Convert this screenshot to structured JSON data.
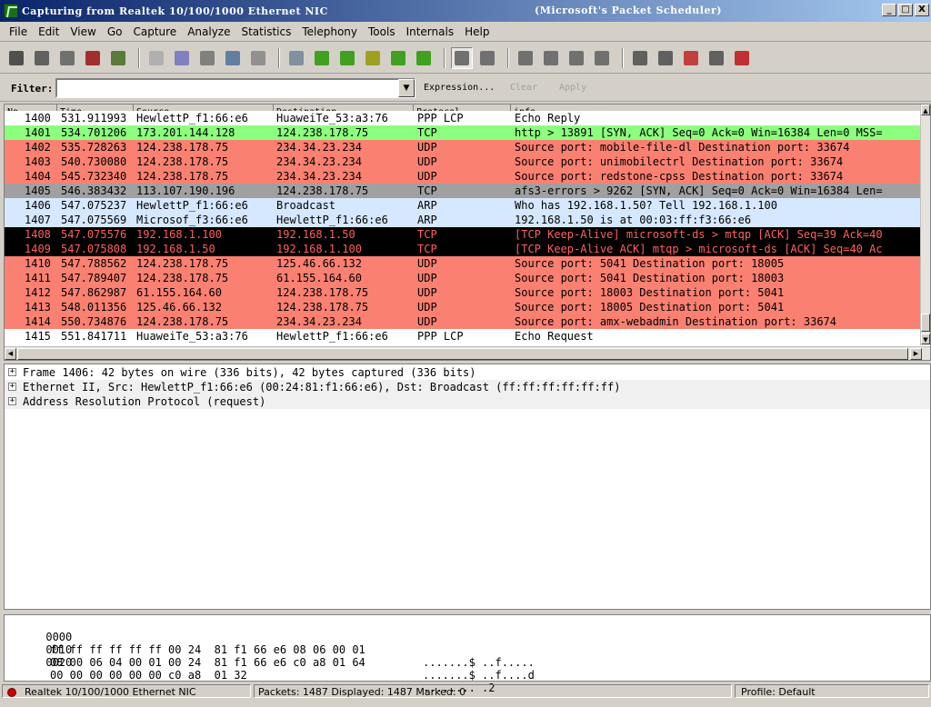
{
  "window": {
    "title": "Capturing from Realtek 10/100/1000 Ethernet NIC",
    "title_part2": "(Microsoft's Packet Scheduler)",
    "controls": [
      "_",
      "□",
      "X"
    ]
  },
  "menu": [
    "File",
    "Edit",
    "View",
    "Go",
    "Capture",
    "Analyze",
    "Statistics",
    "Telephony",
    "Tools",
    "Internals",
    "Help"
  ],
  "toolbar": {
    "icons": [
      {
        "name": "interfaces-icon",
        "color": "#505050"
      },
      {
        "name": "options-icon",
        "color": "#606060"
      },
      {
        "name": "start-capture-icon",
        "color": "#707070"
      },
      {
        "name": "stop-capture-icon",
        "color": "#a03030"
      },
      {
        "name": "restart-capture-icon",
        "color": "#5a7a3a"
      },
      {
        "name": "open-icon",
        "color": "#b0b0b0"
      },
      {
        "name": "save-icon",
        "color": "#8080c0"
      },
      {
        "name": "close-icon",
        "color": "#808080"
      },
      {
        "name": "reload-icon",
        "color": "#6080a0"
      },
      {
        "name": "print-icon",
        "color": "#909090"
      },
      {
        "name": "find-icon",
        "color": "#8090a0"
      },
      {
        "name": "back-icon",
        "color": "#40a020"
      },
      {
        "name": "forward-icon",
        "color": "#40a020"
      },
      {
        "name": "goto-icon",
        "color": "#a0a020"
      },
      {
        "name": "first-packet-icon",
        "color": "#40a020"
      },
      {
        "name": "last-packet-icon",
        "color": "#40a020"
      },
      {
        "name": "colorize-icon",
        "color": "#707070"
      },
      {
        "name": "autoscroll-icon",
        "color": "#707070"
      },
      {
        "name": "zoom-in-icon",
        "color": "#707070"
      },
      {
        "name": "zoom-out-icon",
        "color": "#707070"
      },
      {
        "name": "normal-size-icon",
        "color": "#707070"
      },
      {
        "name": "resize-columns-icon",
        "color": "#707070"
      },
      {
        "name": "capture-filters-icon",
        "color": "#606060"
      },
      {
        "name": "display-filters-icon",
        "color": "#606060"
      },
      {
        "name": "coloring-rules-icon",
        "color": "#c04040"
      },
      {
        "name": "preferences-icon",
        "color": "#606060"
      },
      {
        "name": "help-icon",
        "color": "#c03030"
      }
    ]
  },
  "filter": {
    "label": "Filter:",
    "value": "",
    "expression": "Expression...",
    "clear": "Clear",
    "apply": "Apply"
  },
  "packet_list": {
    "columns": [
      "No.",
      "Time",
      "Source",
      "Destination",
      "Protocol",
      "info."
    ],
    "rows": [
      {
        "no": "1400",
        "time": "531.911993",
        "src": "HewlettP_f1:66:e6",
        "dst": "HuaweiTe_53:a3:76",
        "proto": "PPP LCP",
        "info": "Echo Reply",
        "bg": "#ffffff",
        "fg": "#000000"
      },
      {
        "no": "1401",
        "time": "534.701206",
        "src": "173.201.144.128",
        "dst": "124.238.178.75",
        "proto": "TCP",
        "info": "http > 13891 [SYN, ACK] Seq=0 Ack=0 Win=16384 Len=0 MSS=",
        "bg": "#8cff7f",
        "fg": "#000000"
      },
      {
        "no": "1402",
        "time": "535.728263",
        "src": "124.238.178.75",
        "dst": "234.34.23.234",
        "proto": "UDP",
        "info": "Source port: mobile-file-dl  Destination port: 33674",
        "bg": "#fa8072",
        "fg": "#000000"
      },
      {
        "no": "1403",
        "time": "540.730080",
        "src": "124.238.178.75",
        "dst": "234.34.23.234",
        "proto": "UDP",
        "info": "Source port: unimobilectrl  Destination port: 33674",
        "bg": "#fa8072",
        "fg": "#000000"
      },
      {
        "no": "1404",
        "time": "545.732340",
        "src": "124.238.178.75",
        "dst": "234.34.23.234",
        "proto": "UDP",
        "info": "Source port: redstone-cpss  Destination port: 33674",
        "bg": "#fa8072",
        "fg": "#000000"
      },
      {
        "no": "1405",
        "time": "546.383432",
        "src": "113.107.190.196",
        "dst": "124.238.178.75",
        "proto": "TCP",
        "info": "afs3-errors > 9262 [SYN, ACK] Seq=0 Ack=0 Win=16384 Len=",
        "bg": "#a0a0a0",
        "fg": "#000000"
      },
      {
        "no": "1406",
        "time": "547.075237",
        "src": "HewlettP_f1:66:e6",
        "dst": "Broadcast",
        "proto": "ARP",
        "info": "Who has 192.168.1.50?  Tell 192.168.1.100",
        "bg": "#d6e8ff",
        "fg": "#000000"
      },
      {
        "no": "1407",
        "time": "547.075569",
        "src": "Microsof_f3:66:e6",
        "dst": "HewlettP_f1:66:e6",
        "proto": "ARP",
        "info": "192.168.1.50 is at 00:03:ff:f3:66:e6",
        "bg": "#d6e8ff",
        "fg": "#000000"
      },
      {
        "no": "1408",
        "time": "547.075576",
        "src": "192.168.1.100",
        "dst": "192.168.1.50",
        "proto": "TCP",
        "info": "[TCP Keep-Alive] microsoft-ds > mtqp [ACK] Seq=39 Ack=40",
        "bg": "#000000",
        "fg": "#ff5f5f"
      },
      {
        "no": "1409",
        "time": "547.075808",
        "src": "192.168.1.50",
        "dst": "192.168.1.100",
        "proto": "TCP",
        "info": "[TCP Keep-Alive ACK] mtqp > microsoft-ds [ACK] Seq=40 Ac",
        "bg": "#000000",
        "fg": "#ff5f5f"
      },
      {
        "no": "1410",
        "time": "547.788562",
        "src": "124.238.178.75",
        "dst": "125.46.66.132",
        "proto": "UDP",
        "info": "Source port: 5041  Destination port: 18005",
        "bg": "#fa8072",
        "fg": "#000000"
      },
      {
        "no": "1411",
        "time": "547.789407",
        "src": "124.238.178.75",
        "dst": "61.155.164.60",
        "proto": "UDP",
        "info": "Source port: 5041  Destination port: 18003",
        "bg": "#fa8072",
        "fg": "#000000"
      },
      {
        "no": "1412",
        "time": "547.862987",
        "src": "61.155.164.60",
        "dst": "124.238.178.75",
        "proto": "UDP",
        "info": "Source port: 18003  Destination port: 5041",
        "bg": "#fa8072",
        "fg": "#000000"
      },
      {
        "no": "1413",
        "time": "548.011356",
        "src": "125.46.66.132",
        "dst": "124.238.178.75",
        "proto": "UDP",
        "info": "Source port: 18005  Destination port: 5041",
        "bg": "#fa8072",
        "fg": "#000000"
      },
      {
        "no": "1414",
        "time": "550.734876",
        "src": "124.238.178.75",
        "dst": "234.34.23.234",
        "proto": "UDP",
        "info": "Source port: amx-webadmin  Destination port: 33674",
        "bg": "#fa8072",
        "fg": "#000000"
      },
      {
        "no": "1415",
        "time": "551.841711",
        "src": "HuaweiTe_53:a3:76",
        "dst": "HewlettP_f1:66:e6",
        "proto": "PPP LCP",
        "info": "Echo Request",
        "bg": "#ffffff",
        "fg": "#000000"
      }
    ]
  },
  "details": [
    "Frame 1406: 42 bytes on wire (336 bits), 42 bytes captured (336 bits)",
    "Ethernet II, Src: HewlettP_f1:66:e6 (00:24:81:f1:66:e6), Dst: Broadcast (ff:ff:ff:ff:ff:ff)",
    "Address Resolution Protocol (request)"
  ],
  "bytes": [
    {
      "offset": "0000",
      "hex": "ff ff ff ff ff ff 00 24  81 f1 66 e6 08 06 00 01",
      "ascii": ".......$ ..f....."
    },
    {
      "offset": "0010",
      "hex": "08 00 06 04 00 01 00 24  81 f1 66 e6 c0 a8 01 64",
      "ascii": ".......$ ..f....d"
    },
    {
      "offset": "0020",
      "hex": "00 00 00 00 00 00 c0 a8  01 32",
      "ascii": "........ .2"
    }
  ],
  "status": {
    "interface": "Realtek 10/100/1000 Ethernet NIC",
    "packets": "Packets: 1487 Displayed: 1487 Marked: 0",
    "profile": "Profile: Default"
  }
}
